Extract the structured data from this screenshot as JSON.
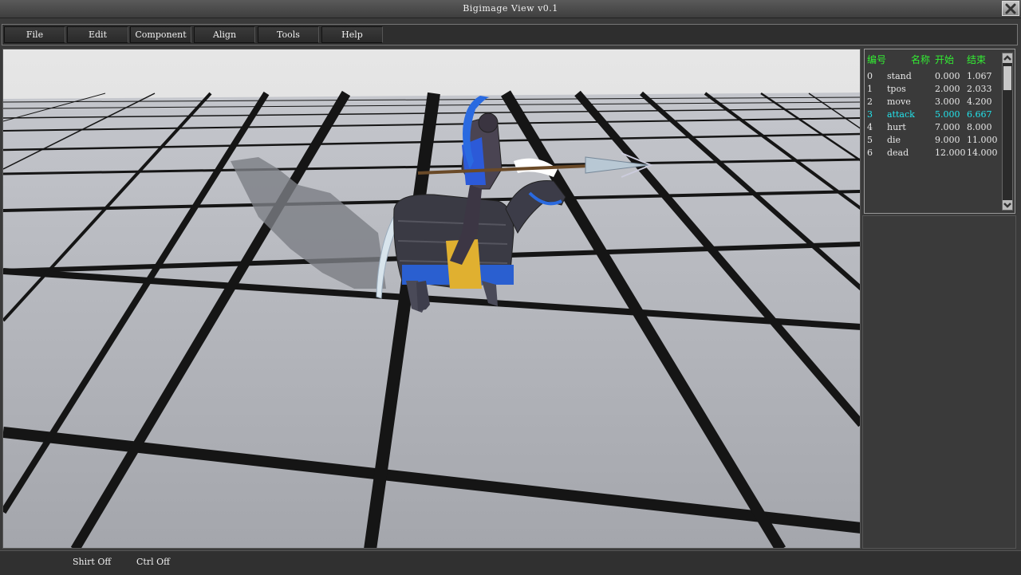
{
  "window": {
    "title": "Bigimage View v0.1",
    "close_icon": "close-icon"
  },
  "menu": {
    "items": [
      {
        "label": "File"
      },
      {
        "label": "Edit"
      },
      {
        "label": "Component"
      },
      {
        "label": "Align"
      },
      {
        "label": "Tools"
      },
      {
        "label": "Help"
      }
    ]
  },
  "animations": {
    "headers": {
      "id": "编号",
      "name": "名称",
      "start": "开始",
      "end": "结束"
    },
    "rows": [
      {
        "id": "0",
        "name": "stand",
        "start": "0.000",
        "end": "1.067"
      },
      {
        "id": "1",
        "name": "tpos",
        "start": "2.000",
        "end": "2.033"
      },
      {
        "id": "2",
        "name": "move",
        "start": "3.000",
        "end": "4.200"
      },
      {
        "id": "3",
        "name": "attack",
        "start": "5.000",
        "end": "6.667",
        "selected": true
      },
      {
        "id": "4",
        "name": "hurt",
        "start": "7.000",
        "end": "8.000"
      },
      {
        "id": "5",
        "name": "die",
        "start": "9.000",
        "end": "11.000"
      },
      {
        "id": "6",
        "name": "dead",
        "start": "12.000",
        "end": "14.000"
      }
    ],
    "header_color": "#33ee33",
    "selected_color": "#22e6ee"
  },
  "status": {
    "shift": "Shirt Off",
    "ctrl": "Ctrl Off"
  },
  "viewport": {
    "content": "3d-model-cavalry-rider"
  }
}
